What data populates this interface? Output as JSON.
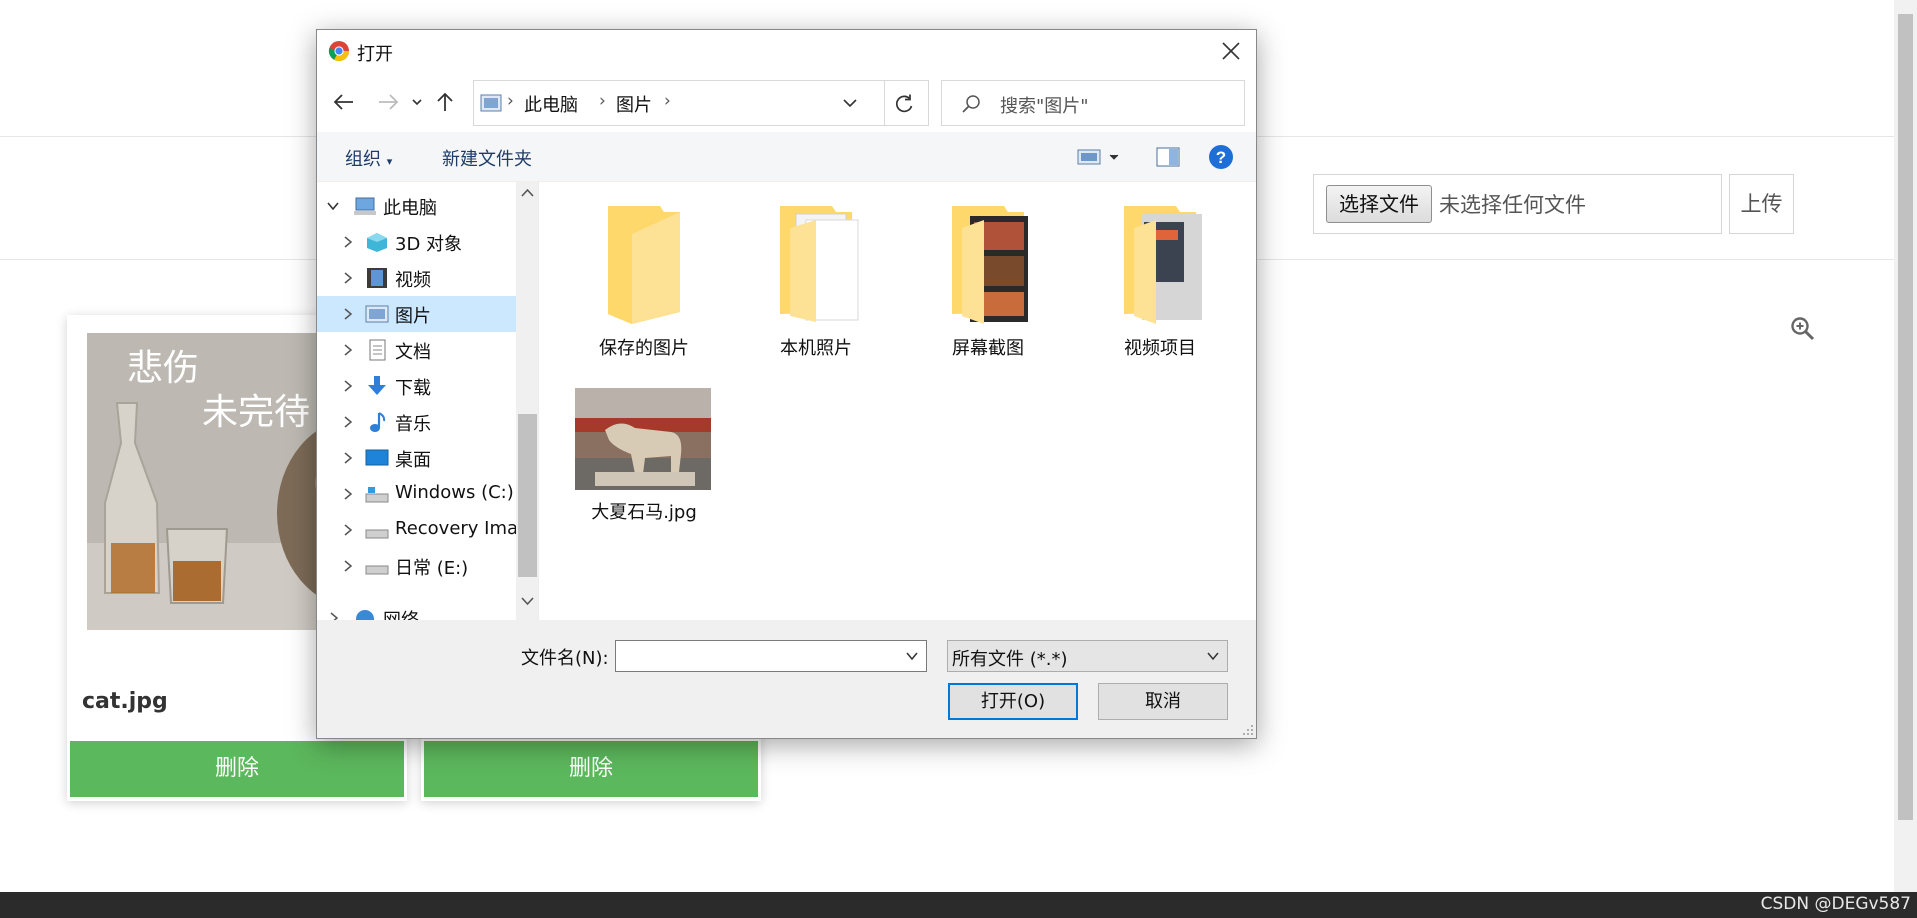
{
  "page": {
    "choose_file_label": "选择文件",
    "no_file_text": "未选择任何文件",
    "upload_label": "上传",
    "cards": [
      {
        "file_name": "cat.jpg",
        "delete_label": "删除",
        "overlay_line1": "悲伤",
        "overlay_line2": "未完待"
      },
      {
        "file_name": "",
        "delete_label": "删除"
      }
    ],
    "watermark": "CSDN @DEGv587"
  },
  "dialog": {
    "title": "打开",
    "address": {
      "crumbs": [
        "此电脑",
        "图片"
      ]
    },
    "search_placeholder": "搜索\"图片\"",
    "toolbar": {
      "organize": "组织",
      "new_folder": "新建文件夹"
    },
    "tree": [
      {
        "label": "此电脑",
        "icon": "computer-icon",
        "expanded": true
      },
      {
        "label": "3D 对象",
        "icon": "3d-objects-icon"
      },
      {
        "label": "视频",
        "icon": "video-icon"
      },
      {
        "label": "图片",
        "icon": "pictures-icon",
        "selected": true
      },
      {
        "label": "文档",
        "icon": "document-icon"
      },
      {
        "label": "下载",
        "icon": "download-icon"
      },
      {
        "label": "音乐",
        "icon": "music-icon"
      },
      {
        "label": "桌面",
        "icon": "desktop-icon"
      },
      {
        "label": "Windows (C:)",
        "icon": "drive-icon"
      },
      {
        "label": "Recovery Imag",
        "icon": "drive-icon"
      },
      {
        "label": "日常 (E:)",
        "icon": "drive-icon"
      },
      {
        "label": "网络",
        "icon": "network-icon"
      }
    ],
    "files": [
      {
        "name": "保存的图片",
        "type": "folder"
      },
      {
        "name": "本机照片",
        "type": "folder"
      },
      {
        "name": "屏幕截图",
        "type": "folder"
      },
      {
        "name": "视频项目",
        "type": "folder"
      },
      {
        "name": "大夏石马.jpg",
        "type": "image"
      }
    ],
    "filename_label": "文件名(N):",
    "filename_value": "",
    "filetype_value": "所有文件 (*.*)",
    "open_label": "打开(O)",
    "cancel_label": "取消"
  }
}
